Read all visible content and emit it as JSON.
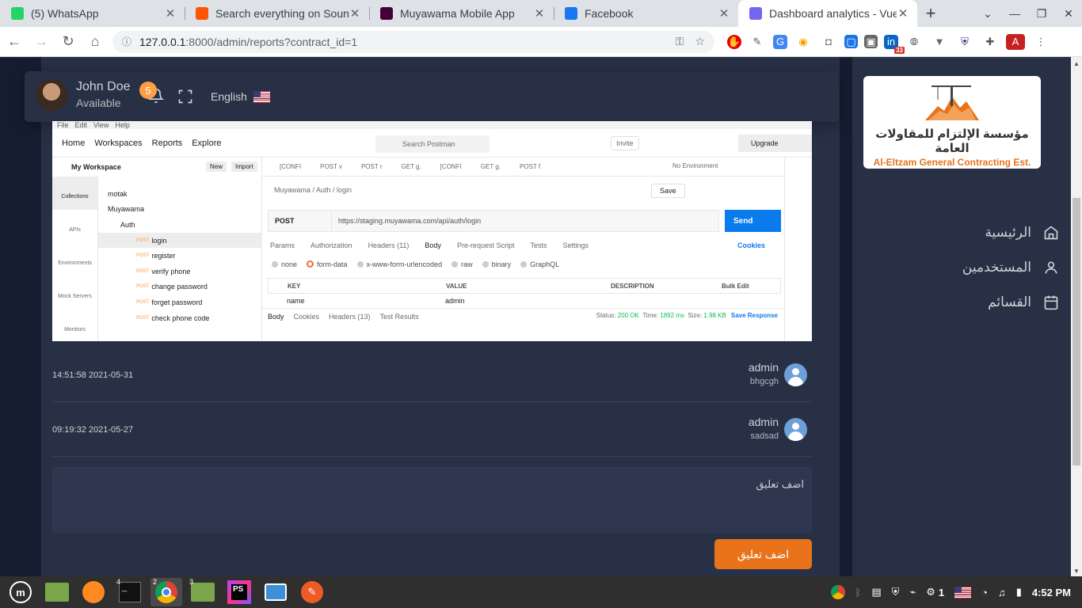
{
  "browser": {
    "tabs": [
      {
        "title": "(5) WhatsApp",
        "icon": "whatsapp-icon",
        "color": "#25d366"
      },
      {
        "title": "Search everything on SoundCloud",
        "icon": "soundcloud-icon",
        "color": "#ff5500"
      },
      {
        "title": "Muyawama Mobile App",
        "icon": "adobe-xd-icon",
        "color": "#470137"
      },
      {
        "title": "Facebook",
        "icon": "facebook-icon",
        "color": "#1877f2"
      },
      {
        "title": "Dashboard analytics - Vuexy",
        "icon": "vuexy-icon",
        "color": "#7367f0"
      }
    ],
    "url_host": "127.0.0.1",
    "url_rest": ":8000/admin/reports?contract_id=1",
    "profile_initial": "A",
    "ext_badge": "33"
  },
  "navbar": {
    "user_name": "John Doe",
    "user_status": "Available",
    "notification_count": "5",
    "language": "English"
  },
  "sidebar": {
    "logo_ar": "مؤسسة الإلتزام للمقاولات العامة",
    "logo_en": "Al-Eltzam General Contracting Est.",
    "items": [
      {
        "label": "الرئيسية",
        "icon": "home-icon"
      },
      {
        "label": "المستخدمين",
        "icon": "user-icon"
      },
      {
        "label": "القسائم",
        "icon": "calendar-icon"
      }
    ]
  },
  "postman": {
    "menu": [
      "File",
      "Edit",
      "View",
      "Help"
    ],
    "nav": [
      "Home",
      "Workspaces",
      "Reports",
      "Explore"
    ],
    "search": "Search Postman",
    "invite": "Invite",
    "upgrade": "Upgrade",
    "workspace": "My Workspace",
    "new_btn": "New",
    "import_btn": "Import",
    "rail": [
      "Collections",
      "APIs",
      "Environments",
      "Mock Servers",
      "Monitors"
    ],
    "tree": [
      {
        "label": "motak",
        "indent": 12,
        "method": ""
      },
      {
        "label": "Muyawama",
        "indent": 12,
        "method": ""
      },
      {
        "label": "Auth",
        "indent": 28,
        "method": ""
      },
      {
        "label": "login",
        "indent": 48,
        "method": "POST"
      },
      {
        "label": "register",
        "indent": 48,
        "method": "POST"
      },
      {
        "label": "verify phone",
        "indent": 48,
        "method": "POST"
      },
      {
        "label": "change password",
        "indent": 48,
        "method": "POST"
      },
      {
        "label": "forget password",
        "indent": 48,
        "method": "POST"
      },
      {
        "label": "check phone code",
        "indent": 48,
        "method": "POST"
      }
    ],
    "open_tabs": [
      "[CONFI",
      "POST v",
      "POST r",
      "GET g.",
      "[CONFI",
      "GET g.",
      "POST f"
    ],
    "environment": "No Environment",
    "crumb": "Muyawama / Auth / login",
    "save": "Save",
    "method": "POST",
    "url": "https://staging.muyawama.com/api/auth/login",
    "send": "Send",
    "req_tabs": [
      "Params",
      "Authorization",
      "Headers (11)",
      "Body",
      "Pre-request Script",
      "Tests",
      "Settings"
    ],
    "cookies": "Cookies",
    "body_types": [
      "none",
      "form-data",
      "x-www-form-urlencoded",
      "raw",
      "binary",
      "GraphQL"
    ],
    "kv_headers": [
      "KEY",
      "VALUE",
      "DESCRIPTION",
      "Bulk Edit"
    ],
    "kv_row": [
      "name",
      "admin"
    ],
    "resp_tabs": [
      "Body",
      "Cookies",
      "Headers (13)",
      "Test Results"
    ],
    "status": "200 OK",
    "time": "1892 ms",
    "size": "1.98 KB",
    "save_response": "Save Response"
  },
  "comments": [
    {
      "date": "14:51:58 2021-05-31",
      "author": "admin",
      "text": "bhgcgh"
    },
    {
      "date": "09:19:32 2021-05-27",
      "author": "admin",
      "text": "sadsad"
    }
  ],
  "comment_box": {
    "placeholder": "اضف تعليق",
    "button": "اضف تعليق"
  },
  "taskbar": {
    "time": "4:52 PM",
    "keyboard": "1"
  }
}
